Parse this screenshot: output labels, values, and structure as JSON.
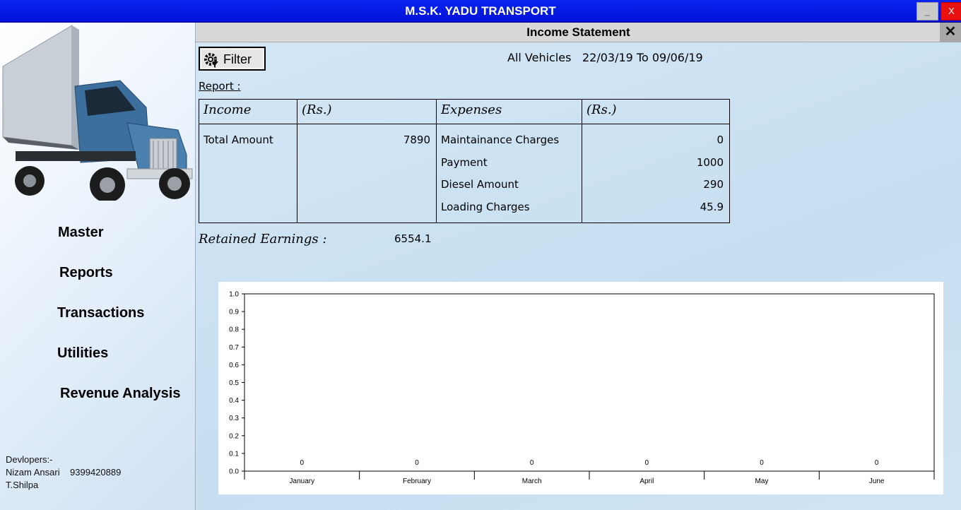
{
  "window": {
    "title": "M.S.K. YADU TRANSPORT",
    "minimize_label": "_",
    "close_label": "X"
  },
  "sidebar": {
    "nav": [
      "Master",
      "Reports",
      "Transactions",
      "Utilities",
      "Revenue Analysis"
    ],
    "developers": {
      "heading": "Devlopers:-",
      "line1": "Nizam Ansari    9399420889",
      "line2": "T.Shilpa"
    }
  },
  "statement": {
    "title": "Income Statement",
    "close_label": "✕",
    "filter_label": "Filter",
    "vehicles": "All Vehicles",
    "date_range": "22/03/19 To 09/06/19",
    "report_label": "Report :",
    "headers": {
      "income": "Income",
      "income_rs": "(Rs.)",
      "expenses": "Expenses",
      "expenses_rs": "(Rs.)"
    },
    "income": {
      "label": "Total Amount",
      "value": "7890"
    },
    "expenses": [
      {
        "label": "Maintainance Charges",
        "value": "0"
      },
      {
        "label": "Payment",
        "value": "1000"
      },
      {
        "label": "Diesel Amount",
        "value": "290"
      },
      {
        "label": "Loading Charges",
        "value": "45.9"
      }
    ],
    "retained_label": "Retained Earnings :",
    "retained_value": "6554.1"
  },
  "chart_data": {
    "type": "bar",
    "categories": [
      "January",
      "February",
      "March",
      "April",
      "May",
      "June"
    ],
    "values": [
      0,
      0,
      0,
      0,
      0,
      0
    ],
    "data_labels": [
      "0",
      "0",
      "0",
      "0",
      "0",
      "0"
    ],
    "ylim": [
      0,
      1.0
    ],
    "y_ticks": [
      "0.0",
      "0.1",
      "0.2",
      "0.3",
      "0.4",
      "0.5",
      "0.6",
      "0.7",
      "0.8",
      "0.9",
      "1.0"
    ],
    "title": "",
    "xlabel": "",
    "ylabel": "",
    "grid": false
  }
}
